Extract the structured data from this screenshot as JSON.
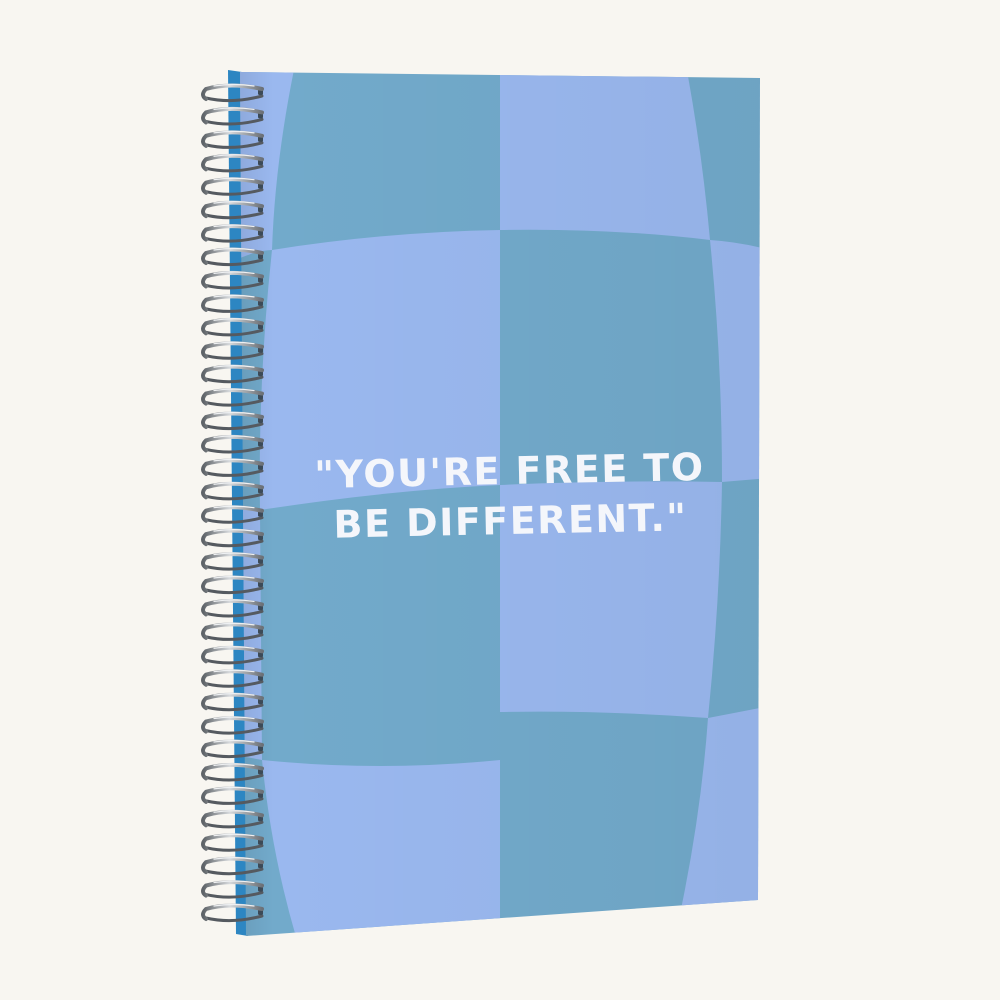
{
  "notebook": {
    "quote_line_1": "\"YOU'RE FREE TO",
    "quote_line_2": "BE DIFFERENT.\""
  },
  "colors": {
    "background": "#f8f6f1",
    "checker_light": "#9ab8ef",
    "checker_dark": "#72aacb",
    "spine": "#2d86c2",
    "text": "#f4f6fb",
    "coil": "#9aa0a6"
  }
}
